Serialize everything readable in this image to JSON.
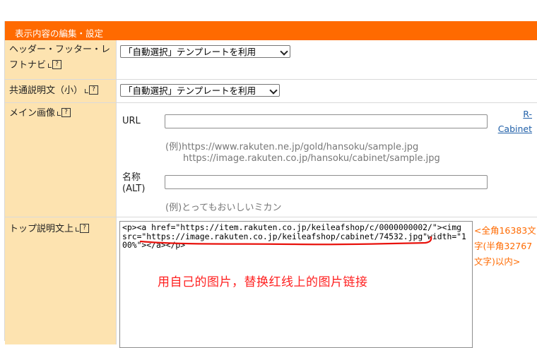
{
  "header": {
    "title": "表示内容の編集・設定"
  },
  "rows": {
    "header_footer": {
      "label": "ヘッダー・フッター・レフトナビ",
      "select_value": "「自動選択」テンプレートを利用"
    },
    "common_desc": {
      "label": "共通説明文（小）",
      "select_value": "「自動選択」テンプレートを利用"
    },
    "main_image": {
      "label": "メイン画像",
      "url_label": "URL",
      "url_value": "",
      "example_1": "(例)https://www.rakuten.ne.jp/gold/hansoku/sample.jpg",
      "example_2": "https://image.rakuten.co.jp/hansoku/cabinet/sample.jpg",
      "alt_label_1": "名称",
      "alt_label_2": "(ALT)",
      "alt_value": "",
      "alt_example": "(例)とってもおいしいミカン",
      "cabinet_link_1": "R-",
      "cabinet_link_2": "Cabinet"
    },
    "top_desc": {
      "label": "トップ説明文上",
      "textarea_value": "<p><a href=\"https://item.rakuten.co.jp/keileafshop/c/0000000002/\"><img src=\"https://image.rakuten.co.jp/keileafshop/cabinet/74532.jpg\"width=\"100%\"></a></p>",
      "limit_note": "<全角16383文字(半角32767文字)以内>",
      "annotation": "用自己的图片，替换红线上的图片链接"
    }
  },
  "colors": {
    "header_bg": "#ff6a00",
    "label_bg": "#fde3b0",
    "annotation": "#ff2020",
    "link": "#1f5fa8"
  },
  "icons": {
    "help": "help-icon"
  }
}
